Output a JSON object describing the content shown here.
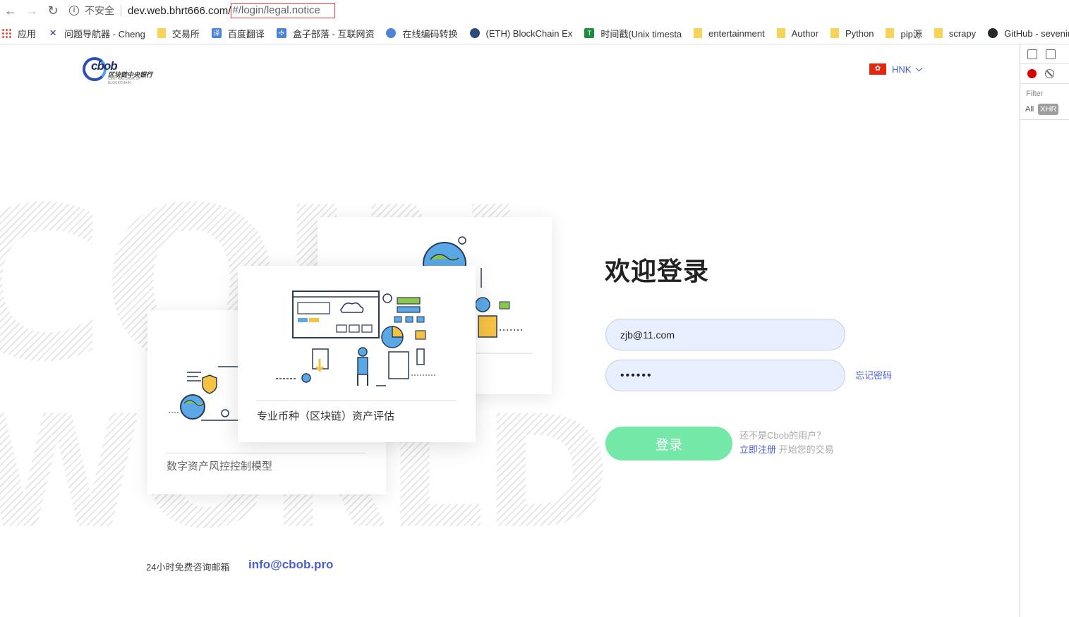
{
  "browser": {
    "security_label": "不安全",
    "url_host": "dev.web.bhrt666.com/",
    "url_hash": "#/login/legal.notice",
    "bookmarks": [
      {
        "label": "应用",
        "icon": "apps-icon"
      },
      {
        "label": "问题导航器 - Cheng",
        "icon": "x-logo-icon"
      },
      {
        "label": "交易所",
        "icon": "folder-icon"
      },
      {
        "label": "百度翻译",
        "icon": "translate-icon"
      },
      {
        "label": "盒子部落 - 互联网资",
        "icon": "puzzle-icon"
      },
      {
        "label": "在线编码转换",
        "icon": "c-logo-icon"
      },
      {
        "label": "(ETH) BlockChain Ex",
        "icon": "eth-icon"
      },
      {
        "label": "时间戳(Unix timesta",
        "icon": "t-logo-icon"
      },
      {
        "label": "entertainment",
        "icon": "folder-icon"
      },
      {
        "label": "Author",
        "icon": "folder-icon"
      },
      {
        "label": "Python",
        "icon": "folder-icon"
      },
      {
        "label": "pip源",
        "icon": "folder-icon"
      },
      {
        "label": "scrapy",
        "icon": "folder-icon"
      },
      {
        "label": "GitHub - sevenirul",
        "icon": "github-icon"
      }
    ]
  },
  "devtools": {
    "filter_label": "Filter",
    "all_label": "All",
    "xhr_label": "XHR"
  },
  "header": {
    "logo_text": "cbob",
    "logo_cn": "区块链中央银行",
    "logo_en": "CENTRAL BANK OF BLOCKCHAIN",
    "language": "HNK"
  },
  "background": {
    "word1": "COIN",
    "word2": "WORLD"
  },
  "cards": {
    "front_caption": "专业币种（区块链）资产评估",
    "left_caption": "数字资产风控控制模型"
  },
  "login": {
    "title": "欢迎登录",
    "email_value": "zjb@11.com",
    "password_value": "••••••",
    "forgot_label": "忘记密码",
    "submit_label": "登录",
    "signup_question": "还不是Cbob的用户？",
    "signup_link": "立即注册",
    "signup_tail": " 开始您的交易"
  },
  "footer": {
    "label": "24小时免费咨询邮箱",
    "email": "info@cbob.pro"
  },
  "colors": {
    "accent": "#4a5fd4",
    "button": "#74e8a6",
    "input_bg": "#e8effe"
  }
}
